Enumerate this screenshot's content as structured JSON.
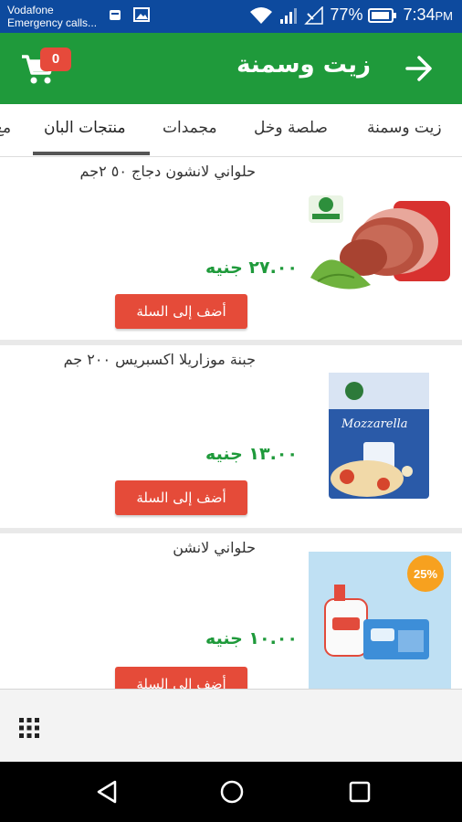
{
  "status_bar": {
    "carrier": "Vodafone",
    "carrier_sub": "Emergency calls...",
    "battery": "77%",
    "time": "7:34",
    "ampm": "PM"
  },
  "header": {
    "title": "زيت وسمنة",
    "cart_count": "0"
  },
  "tabs": [
    {
      "label": "زيت وسمنة"
    },
    {
      "label": "صلصة وخل"
    },
    {
      "label": "مجمدات"
    },
    {
      "label": "منتجات البان"
    },
    {
      "label": "مع"
    }
  ],
  "products": [
    {
      "name": "حلواني لانشون دجاج ٥٠ ٢جم",
      "price": "٢٧.٠٠ جنيه",
      "button": "أضف إلى السلة"
    },
    {
      "name": "جبنة موزاريلا اكسبريس ٢٠٠ جم",
      "price": "١٣.٠٠ جنيه",
      "button": "أضف إلى السلة"
    },
    {
      "name": "حلواني لانشن",
      "price": "١٠.٠٠ جنيه",
      "button": "أضف إلى السلة"
    }
  ],
  "product_images": {
    "mozzarella_brand": "Mozzarella",
    "promo": "25%"
  },
  "colors": {
    "status_bar": "#0d4a9e",
    "app_bar": "#1f9a3b",
    "price": "#1f9a3b",
    "add_button": "#e54b39",
    "badge": "#e64a3b"
  }
}
